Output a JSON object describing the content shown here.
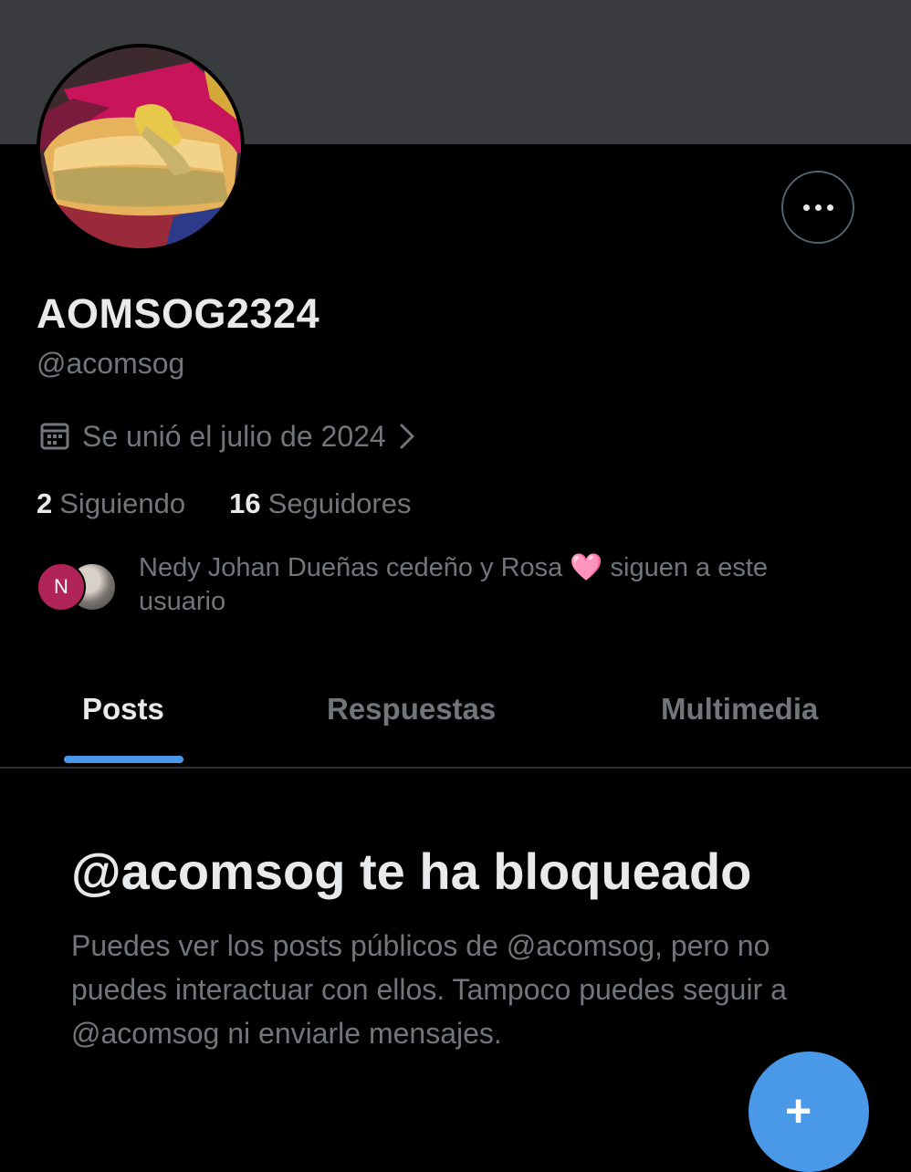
{
  "profile": {
    "display_name": "AOMSOG2324",
    "handle": "@acomsog",
    "joined": "Se unió el julio de 2024",
    "avatar_icon": "food-photo-avatar"
  },
  "actions": {
    "more_icon": "more-horizontal-icon"
  },
  "stats": {
    "following_count": "2",
    "following_label": "Siguiendo",
    "followers_count": "16",
    "followers_label": "Seguidores"
  },
  "mutual": {
    "avatar_initial": "N",
    "text": "Nedy Johan Dueñas cedeño y Rosa 🩷 siguen a este usuario"
  },
  "tabs": [
    {
      "label": "Posts",
      "active": true
    },
    {
      "label": "Respuestas",
      "active": false
    },
    {
      "label": "Multimedia",
      "active": false
    }
  ],
  "blocked": {
    "title": "@acomsog te ha bloqueado",
    "description": "Puedes ver los posts públicos de @acomsog, pero no puedes interactuar con ellos. Tampoco puedes seguir a @acomsog ni enviarle mensajes."
  },
  "colors": {
    "accent": "#4a99e9",
    "background": "#000000",
    "banner": "#3a3b3f",
    "secondary_text": "#71767b",
    "primary_text": "#e7e9ea"
  }
}
